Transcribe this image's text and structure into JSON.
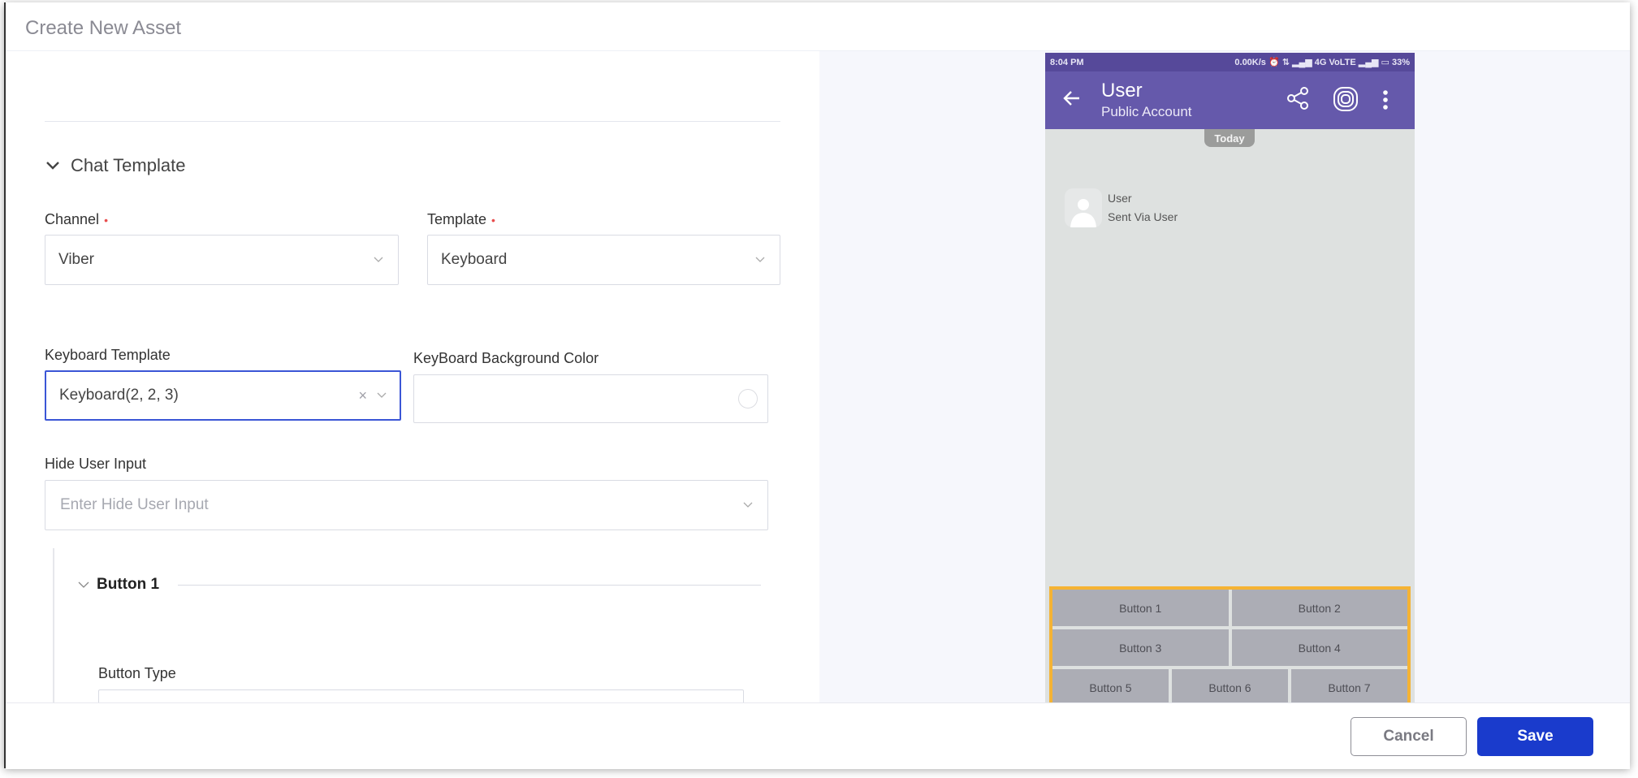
{
  "modal": {
    "title": "Create New Asset"
  },
  "form": {
    "section_title": "Chat Template",
    "channel": {
      "label": "Channel",
      "required": true,
      "value": "Viber"
    },
    "template": {
      "label": "Template",
      "required": true,
      "value": "Keyboard"
    },
    "keyboard_template": {
      "label": "Keyboard Template",
      "value": "Keyboard(2, 2, 3)",
      "clear_icon": "×"
    },
    "keyboard_bg_color": {
      "label": "KeyBoard Background Color",
      "value": ""
    },
    "hide_user_input": {
      "label": "Hide User Input",
      "placeholder": "Enter Hide User Input"
    },
    "button_section": {
      "title": "Button 1",
      "button_type_label": "Button Type"
    },
    "required_mark": "•"
  },
  "preview": {
    "status_bar": {
      "time": "8:04 PM",
      "indicators": "0.00K/s ⏰ ⇅ ▂▄▆ 4G VoLTE ▂▄▆ ▭ 33%"
    },
    "app_bar": {
      "title": "User",
      "subtitle": "Public Account"
    },
    "date_badge": "Today",
    "message": {
      "sender": "User",
      "text": "Sent Via User"
    },
    "keyboard": {
      "highlight_color": "#f5b334",
      "rows": [
        [
          "Button 1",
          "Button 2"
        ],
        [
          "Button 3",
          "Button 4"
        ],
        [
          "Button 5",
          "Button 6",
          "Button 7"
        ]
      ]
    }
  },
  "footer": {
    "cancel_label": "Cancel",
    "save_label": "Save"
  },
  "colors": {
    "primary": "#1a3bcc",
    "viber_purple": "#6559ab",
    "required": "#e84d4d"
  }
}
